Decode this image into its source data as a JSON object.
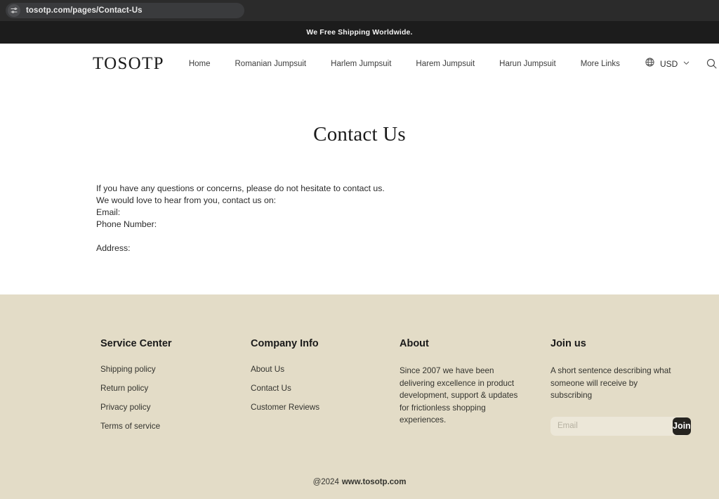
{
  "browser": {
    "url": "tosotp.com/pages/Contact-Us",
    "tune_icon": "sliders-icon"
  },
  "announcement": {
    "text": "We Free Shipping Worldwide."
  },
  "header": {
    "logo": "TOSOTP",
    "nav": [
      {
        "label": "Home"
      },
      {
        "label": "Romanian Jumpsuit"
      },
      {
        "label": "Harlem Jumpsuit"
      },
      {
        "label": "Harem Jumpsuit"
      },
      {
        "label": "Harun Jumpsuit"
      },
      {
        "label": "More Links"
      }
    ],
    "currency": "USD",
    "icons": {
      "globe": "globe-icon",
      "chevron": "chevron-down-icon",
      "search": "search-icon",
      "account": "account-icon",
      "cart": "cart-icon"
    }
  },
  "main": {
    "title": "Contact Us",
    "lines": [
      "If you have any questions or concerns, please do not hesitate to contact us.",
      "We would love to hear from you, contact us on:",
      "Email:",
      "Phone Number:"
    ],
    "address_label": "Address:"
  },
  "footer": {
    "columns": {
      "service": {
        "heading": "Service Center",
        "links": [
          "Shipping policy",
          "Return policy",
          "Privacy policy",
          "Terms of service"
        ]
      },
      "company": {
        "heading": "Company Info",
        "links": [
          "About Us",
          "Contact Us",
          "Customer Reviews"
        ]
      },
      "about": {
        "heading": "About",
        "text": "Since 2007 we have been delivering excellence in product development, support & updates for frictionless shopping experiences."
      },
      "join": {
        "heading": "Join us",
        "description": "A short sentence describing what someone will receive by subscribing",
        "email_placeholder": "Email",
        "email_value": "",
        "button_label": "Join"
      }
    },
    "copyright": "@2024",
    "site_url": "www.tosotp.com"
  },
  "colors": {
    "footer_bg": "#e3dcc7",
    "announcement_bg": "#1c1c1c",
    "join_button": "#262420",
    "chrome_bg": "#2b2b2b"
  }
}
